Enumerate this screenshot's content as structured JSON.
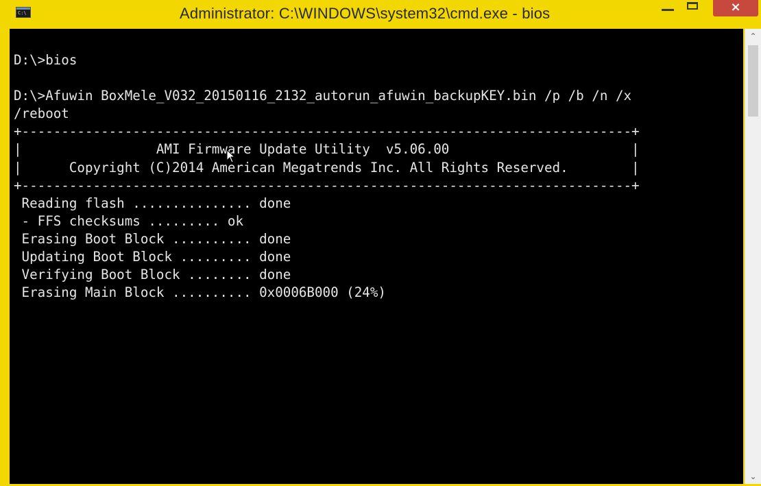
{
  "window": {
    "title": "Administrator: C:\\WINDOWS\\system32\\cmd.exe - bios",
    "icon": "cmd-console-icon",
    "icon_text": "C:\\",
    "controls": {
      "minimize": "minimize-icon",
      "maximize": "maximize-icon",
      "close_label": "×"
    },
    "accent_color": "#f3d700",
    "close_color": "#c7483c"
  },
  "console": {
    "background": "#000000",
    "foreground": "#e6e6e6",
    "lines": [
      "D:\\>bios",
      "",
      "D:\\>Afuwin BoxMele_V032_20150116_2132_autorun_afuwin_backupKEY.bin /p /b /n /x",
      "/reboot",
      "+-----------------------------------------------------------------------------+",
      "|                 AMI Firmware Update Utility  v5.06.00                       |",
      "|      Copyright (C)2014 American Megatrends Inc. All Rights Reserved.        |",
      "+-----------------------------------------------------------------------------+",
      " Reading flash ............... done",
      " - FFS checksums ......... ok",
      " Erasing Boot Block .......... done",
      " Updating Boot Block ......... done",
      " Verifying Boot Block ........ done",
      " Erasing Main Block .......... 0x0006B000 (24%)"
    ]
  },
  "scrollbar": {
    "up_icon": "scroll-up-arrow-icon",
    "up_glyph": "⌃",
    "down_icon": "scroll-down-arrow-icon",
    "down_glyph": "⌄"
  }
}
